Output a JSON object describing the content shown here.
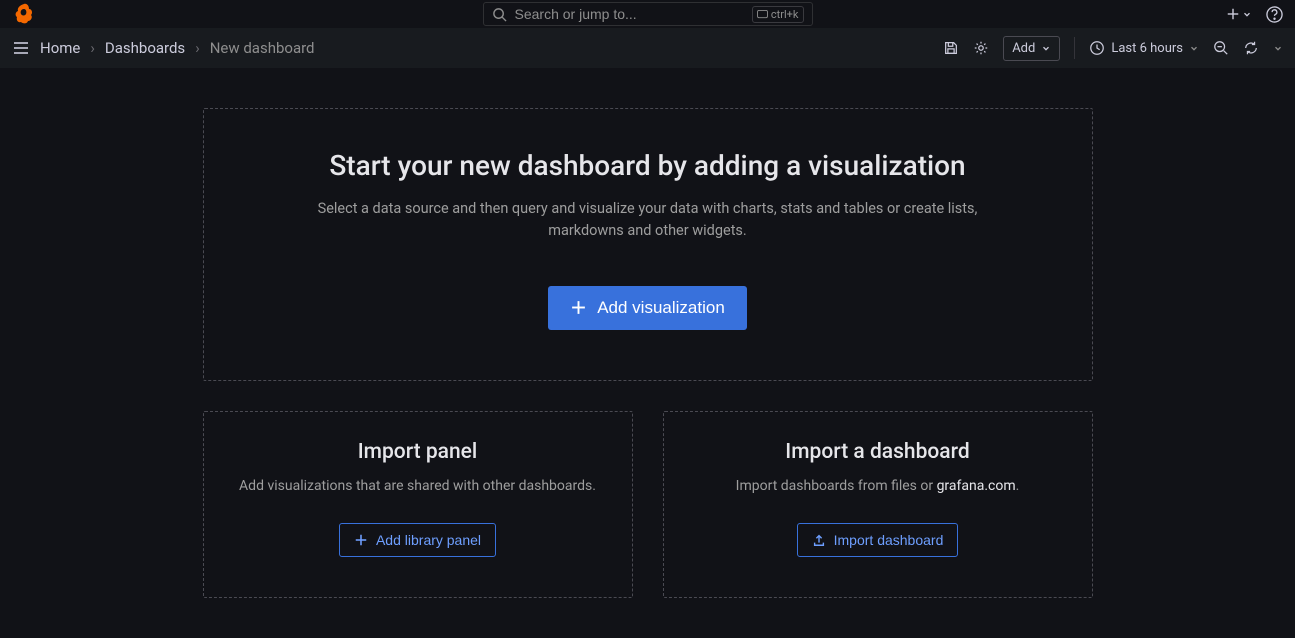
{
  "search": {
    "placeholder": "Search or jump to...",
    "shortcut": "ctrl+k"
  },
  "breadcrumb": {
    "home": "Home",
    "dashboards": "Dashboards",
    "current": "New dashboard"
  },
  "toolbar": {
    "add_label": "Add",
    "time_range": "Last 6 hours"
  },
  "hero": {
    "title": "Start your new dashboard by adding a visualization",
    "subtitle": "Select a data source and then query and visualize your data with charts, stats and tables or create lists, markdowns and other widgets.",
    "button": "Add visualization"
  },
  "import_panel": {
    "title": "Import panel",
    "subtitle": "Add visualizations that are shared with other dashboards.",
    "button": "Add library panel"
  },
  "import_dashboard": {
    "title": "Import a dashboard",
    "subtitle_pre": "Import dashboards from files or ",
    "subtitle_link": "grafana.com",
    "subtitle_post": ".",
    "button": "Import dashboard"
  }
}
